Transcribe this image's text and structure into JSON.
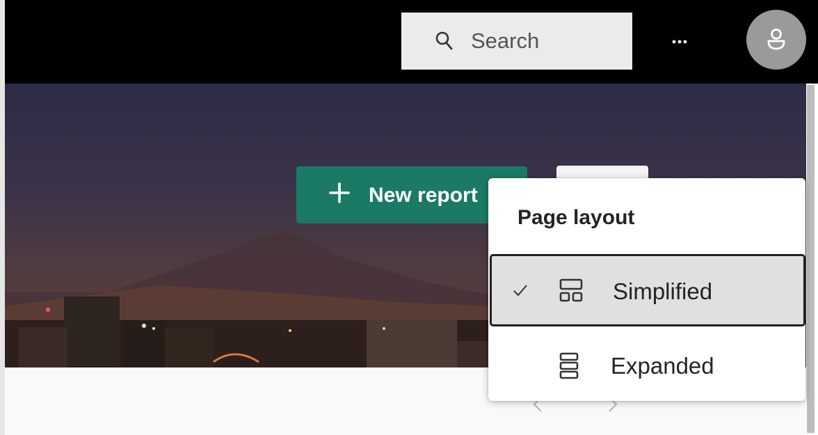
{
  "header": {
    "search": {
      "placeholder": "Search",
      "icon": "search-icon"
    },
    "more_icon": "more-horizontal-icon",
    "avatar_icon": "person-icon",
    "background": "#000000"
  },
  "hero": {
    "new_report": {
      "icon": "plus-icon",
      "label": "New report",
      "color": "#1b7a66"
    }
  },
  "layout_menu": {
    "title": "Page layout",
    "items": [
      {
        "label": "Simplified",
        "icon": "simplified-layout-icon",
        "selected": true
      },
      {
        "label": "Expanded",
        "icon": "expanded-layout-icon",
        "selected": false
      }
    ]
  },
  "carousel": {
    "prev_icon": "chevron-left-icon",
    "next_icon": "chevron-right-icon"
  }
}
